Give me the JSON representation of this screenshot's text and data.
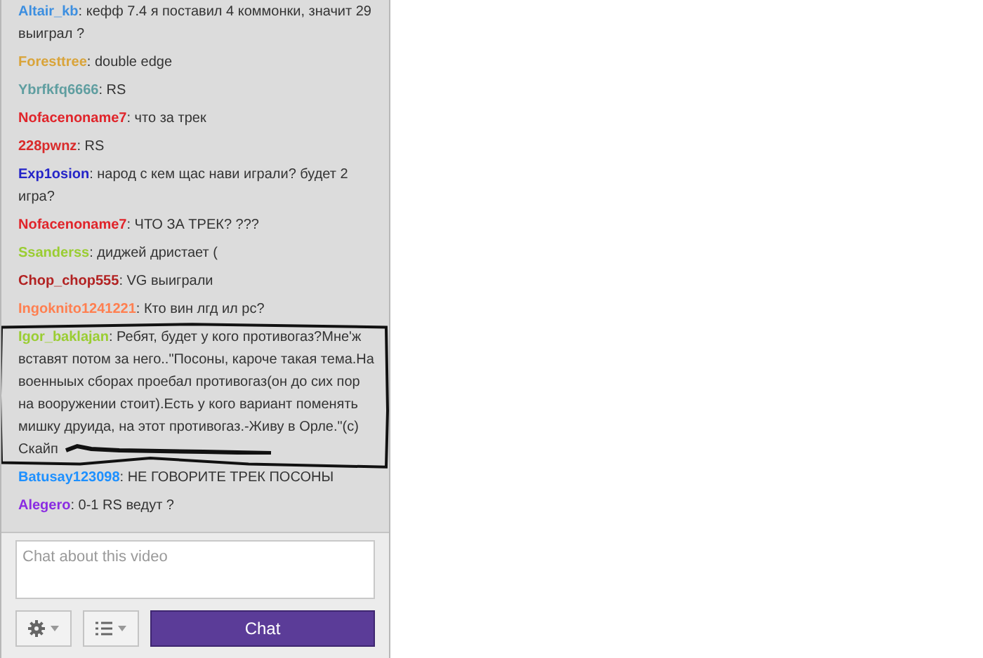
{
  "messages": [
    {
      "user": "Altair_kb",
      "color": "#3d8fe0",
      "text": ": кефф 7.4 я поставил 4 коммонки, значит 29 выиграл ?",
      "circled": false
    },
    {
      "user": "Foresttree",
      "color": "#d9a43a",
      "text": ": double edge",
      "circled": false
    },
    {
      "user": "Ybrfkfq6666",
      "color": "#5f9ea0",
      "text": ": RS",
      "circled": false
    },
    {
      "user": "Nofacenoname7",
      "color": "#e0242a",
      "text": ": что за трек",
      "circled": false
    },
    {
      "user": "228pwnz",
      "color": "#d92b2b",
      "text": ": RS",
      "circled": false
    },
    {
      "user": "Exp1osion",
      "color": "#2424c8",
      "text": ": народ с кем щас нави играли? будет 2 игра?",
      "circled": false
    },
    {
      "user": "Nofacenoname7",
      "color": "#e0242a",
      "text": ": ЧТО ЗА ТРЕК? ???",
      "circled": false
    },
    {
      "user": "Ssanderss",
      "color": "#9acd32",
      "text": ": диджей дристает (",
      "circled": false
    },
    {
      "user": "Chop_chop555",
      "color": "#b22222",
      "text": ": VG выиграли",
      "circled": false
    },
    {
      "user": "Ingoknito1241221",
      "color": "#ff7f50",
      "text": ": Кто вин лгд ил рс?",
      "circled": false
    },
    {
      "user": "Igor_baklajan",
      "color": "#9acd32",
      "text": ": Ребят, будет у кого противогаз?Мне'ж вставят потом за него..\"Посоны, кароче такая тема.На военныых сборах проебал противогаз(он до сих пор на вооружении стоит).Есть у кого вариант поменять мишку друида, на этот противогаз.-Живу в Орле.\"(с) Скайп",
      "circled": true
    },
    {
      "user": "Batusay123098",
      "color": "#1e90ff",
      "text": ": НЕ ГОВОРИТЕ ТРЕК ПОСОНЫ",
      "circled": false
    },
    {
      "user": "Alegero",
      "color": "#8a2be2",
      "text": ": 0-1 RS ведут ?",
      "circled": false
    }
  ],
  "input": {
    "placeholder": "Chat about this video"
  },
  "chat_button": "Chat"
}
